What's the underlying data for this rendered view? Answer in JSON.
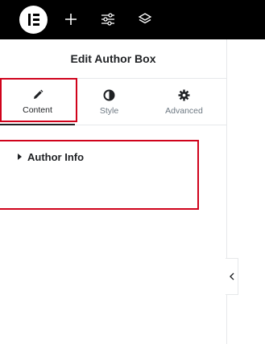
{
  "topbar": {
    "logo_icon": "elementor-logo-icon",
    "add_icon": "plus-icon",
    "settings_icon": "sliders-icon",
    "structure_icon": "layers-icon",
    "background": "#000000"
  },
  "panel": {
    "title": "Edit Author Box",
    "tabs": [
      {
        "label": "Content",
        "icon": "pencil-icon",
        "active": true
      },
      {
        "label": "Style",
        "icon": "half-circle-icon",
        "active": false
      },
      {
        "label": "Advanced",
        "icon": "gear-icon",
        "active": false
      }
    ],
    "section": {
      "label": "Author Info",
      "icon": "caret-right-icon"
    }
  },
  "collapse_handle": {
    "icon": "chevron-left-icon"
  },
  "colors": {
    "highlight": "#d0021b",
    "text": "#1f2124",
    "muted": "#6d7882",
    "divider": "#e6e8ea"
  }
}
